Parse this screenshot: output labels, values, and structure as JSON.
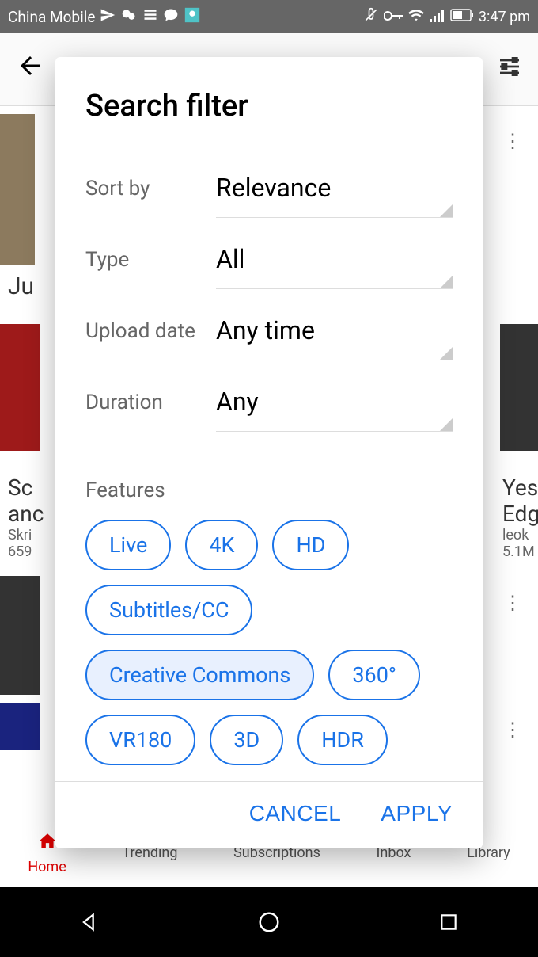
{
  "status": {
    "carrier": "China Mobile",
    "time": "3:47 pm"
  },
  "dialog": {
    "title": "Search filter",
    "rows": {
      "sort_by": {
        "label": "Sort by",
        "value": "Relevance"
      },
      "type": {
        "label": "Type",
        "value": "All"
      },
      "upload_date": {
        "label": "Upload date",
        "value": "Any time"
      },
      "duration": {
        "label": "Duration",
        "value": "Any"
      }
    },
    "features": {
      "title": "Features",
      "chips": [
        "Live",
        "4K",
        "HD",
        "Subtitles/CC",
        "Creative Commons",
        "360°",
        "VR180",
        "3D",
        "HDR"
      ]
    },
    "actions": {
      "cancel": "CANCEL",
      "apply": "APPLY"
    }
  },
  "background": {
    "partial1": "Ju",
    "video1": {
      "title1": "Sc",
      "title2": "anc",
      "channel": "Skri",
      "views": "659"
    },
    "video2": {
      "title1": "Yes",
      "title2": "Edg",
      "channel": "leok",
      "views": "5.1M"
    }
  },
  "nav": {
    "home": "Home",
    "trending": "Trending",
    "subscriptions": "Subscriptions",
    "inbox": "Inbox",
    "library": "Library"
  }
}
